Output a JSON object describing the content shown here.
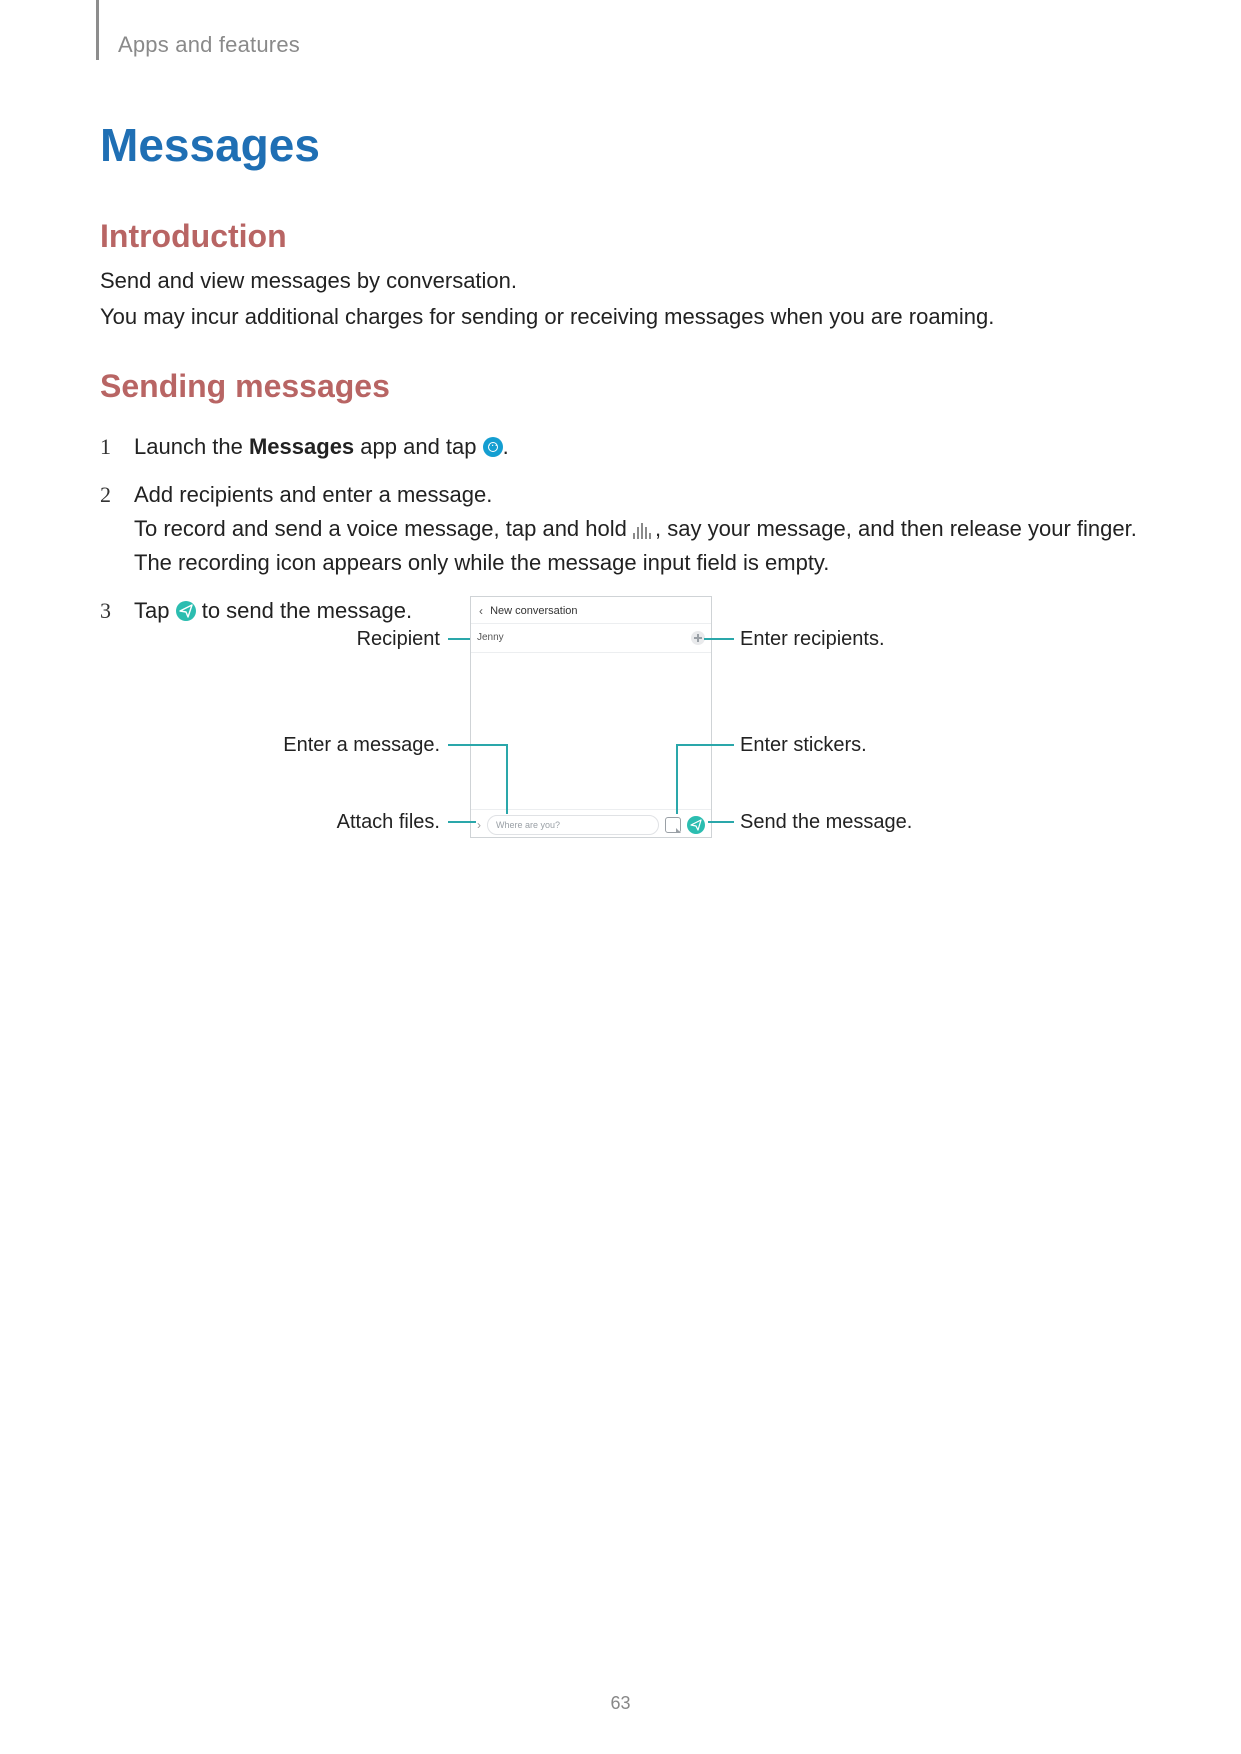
{
  "breadcrumb": "Apps and features",
  "title": "Messages",
  "sections": {
    "intro": {
      "heading": "Introduction",
      "p1": "Send and view messages by conversation.",
      "p2": "You may incur additional charges for sending or receiving messages when you are roaming."
    },
    "sending": {
      "heading": "Sending messages",
      "steps": {
        "s1_pre": "Launch the ",
        "s1_bold": "Messages",
        "s1_post": " app and tap ",
        "s1_end": ".",
        "s2_line1": "Add recipients and enter a message.",
        "s2_line2_pre": "To record and send a voice message, tap and hold ",
        "s2_line2_post": ", say your message, and then release your finger. The recording icon appears only while the message input field is empty.",
        "s3_pre": "Tap ",
        "s3_post": " to send the message."
      }
    }
  },
  "diagram": {
    "phone_header": "New conversation",
    "recipient_value": "Jenny",
    "compose_placeholder": "Where are you?",
    "labels": {
      "left1": "Recipient",
      "left2": "Enter a message.",
      "left3": "Attach files.",
      "right1": "Enter recipients.",
      "right2": "Enter stickers.",
      "right3": "Send the message."
    }
  },
  "page_number": "63"
}
